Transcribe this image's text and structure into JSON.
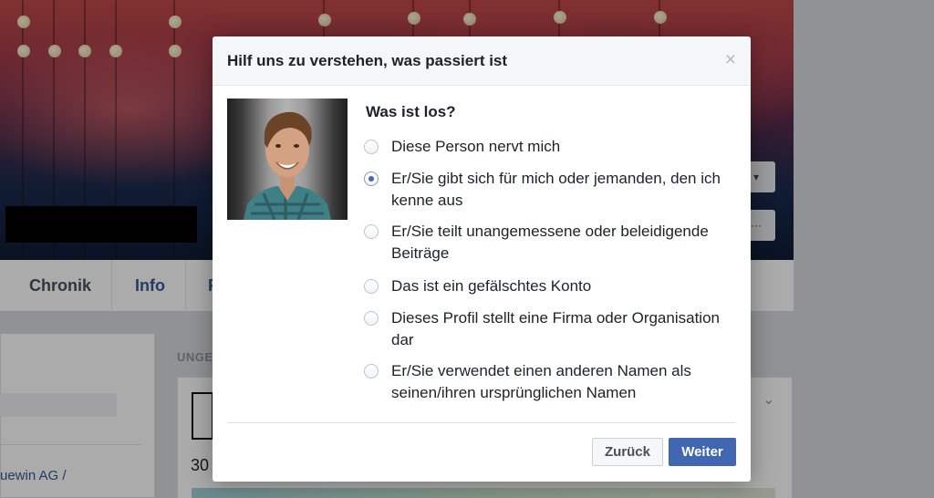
{
  "background": {
    "tabs": [
      {
        "label": "Chronik"
      },
      {
        "label": "Info"
      },
      {
        "label": "F"
      }
    ],
    "section_header": "UNGE",
    "card_number": "30",
    "left_link_text": "uewin AG /",
    "cover_button_icon": "dropdown-caret-icon",
    "more_button_label": "···"
  },
  "dialog": {
    "title": "Hilf uns zu verstehen, was passiert ist",
    "close_icon": "×",
    "question": "Was ist los?",
    "options": [
      {
        "label": "Diese Person nervt mich",
        "checked": false
      },
      {
        "label": "Er/Sie gibt sich für mich oder jemanden, den ich kenne aus",
        "checked": true
      },
      {
        "label": "Er/Sie teilt unangemessene oder beleidigende Beiträge",
        "checked": false
      },
      {
        "label": "Das ist ein gefälschtes Konto",
        "checked": false
      },
      {
        "label": "Dieses Profil stellt eine Firma oder Organisation dar",
        "checked": false
      },
      {
        "label": "Er/Sie verwendet einen anderen Namen als seinen/ihren ursprünglichen Namen",
        "checked": false
      }
    ],
    "buttons": {
      "back": "Zurück",
      "next": "Weiter"
    }
  },
  "colors": {
    "primary": "#4267b2",
    "link": "#365899",
    "text": "#1d2129"
  }
}
